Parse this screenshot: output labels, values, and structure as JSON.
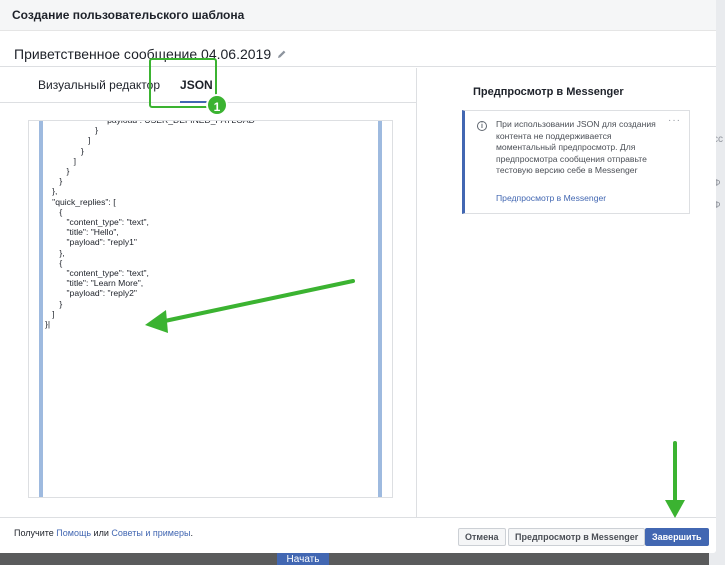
{
  "background": {
    "start_button": "Начать",
    "right_strip": [
      "сс",
      "Ф",
      "Ф"
    ]
  },
  "dialog": {
    "title": "Создание пользовательского шаблона",
    "template_name": "Приветственное сообщение 04.06.2019"
  },
  "tabs": [
    {
      "label": "Визуальный редактор",
      "active": false
    },
    {
      "label": "JSON",
      "active": true
    }
  ],
  "annotation": {
    "badge": "1"
  },
  "editor": {
    "code": "                          payload : USER_DEFINED_PAYLOAD\n                     }\n                  ]\n               }\n            ]\n         }\n      }\n   },\n   \"quick_replies\": [\n      {\n         \"content_type\": \"text\",\n         \"title\": \"Hello\",\n         \"payload\": \"reply1\"\n      },\n      {\n         \"content_type\": \"text\",\n         \"title\": \"Learn More\",\n         \"payload\": \"reply2\"\n      }\n   ]\n}|"
  },
  "preview": {
    "title": "Предпросмотр в Messenger",
    "notice_text": "При использовании JSON для создания контента не поддерживается моментальный предпросмотр. Для предпросмотра сообщения отправьте тестовую версию себе в Messenger",
    "notice_link": "Предпросмотр в Messenger",
    "more": "···"
  },
  "footer": {
    "prefix": "Получите ",
    "help_link": "Помощь",
    "middle": " или ",
    "tips_link": "Советы и примеры",
    "suffix": ".",
    "cancel": "Отмена",
    "preview": "Предпросмотр в Messenger",
    "finish": "Завершить"
  },
  "colors": {
    "accent": "#4267b2",
    "annotation_green": "#3bb331"
  }
}
